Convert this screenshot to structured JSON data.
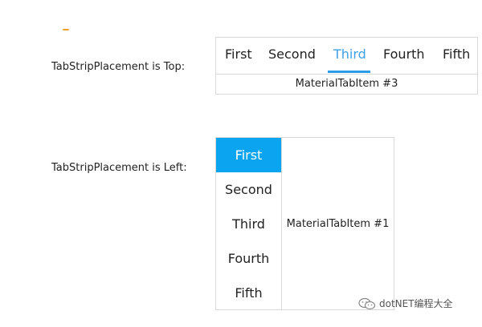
{
  "sections": {
    "top": {
      "label": "TabStripPlacement is Top:",
      "tabs": [
        "First",
        "Second",
        "Third",
        "Fourth",
        "Fifth"
      ],
      "selected_tab": "Third",
      "content": "MaterialTabItem #3"
    },
    "left": {
      "label": "TabStripPlacement is Left:",
      "tabs": [
        "First",
        "Second",
        "Third",
        "Fourth",
        "Fifth"
      ],
      "selected_tab": "First",
      "content": "MaterialTabItem #1"
    }
  },
  "watermark": {
    "text": "dotNET编程大全"
  },
  "colors": {
    "accent": "#0aa4f0",
    "active_text": "#3ea0e6",
    "underline": "#2b9be8",
    "border": "#d9d9d9"
  }
}
